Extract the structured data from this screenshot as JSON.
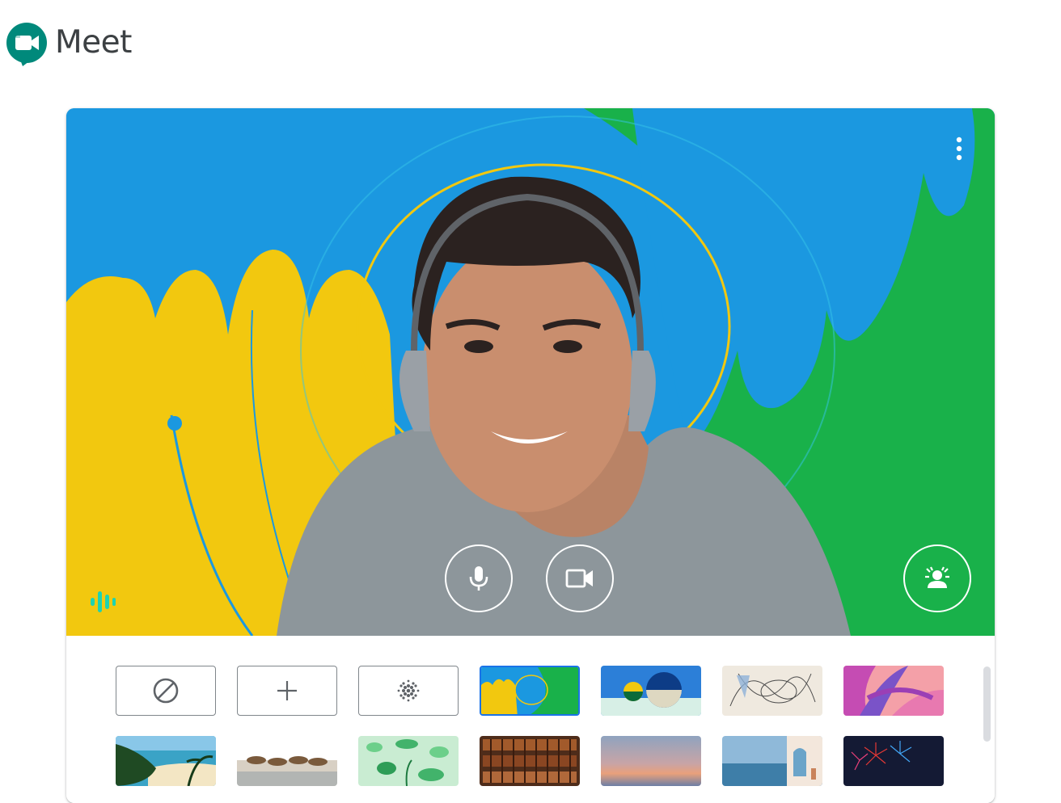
{
  "app": {
    "title": "Meet",
    "logo_icon": "google-meet-logo-icon"
  },
  "preview": {
    "more_options_icon": "more-vert-icon",
    "controls": [
      {
        "name": "microphone-toggle-button",
        "icon": "microphone-icon"
      },
      {
        "name": "camera-toggle-button",
        "icon": "videocam-icon"
      }
    ],
    "effects_button_icon": "visual-effects-icon",
    "audio_indicator_icon": "audio-level-icon"
  },
  "effects": {
    "row1": [
      {
        "name": "no-effect-tile",
        "icon": "no-effect-icon"
      },
      {
        "name": "upload-background-tile",
        "icon": "plus-icon"
      },
      {
        "name": "blur-background-tile",
        "icon": "blur-icon"
      },
      {
        "name": "background-paint-swirl",
        "icon": "thumbnail"
      },
      {
        "name": "background-abstract-spheres",
        "icon": "thumbnail"
      },
      {
        "name": "background-line-sketch",
        "icon": "thumbnail"
      },
      {
        "name": "background-pink-leaves",
        "icon": "thumbnail"
      }
    ],
    "row2": [
      {
        "name": "background-tropical-beach",
        "icon": "thumbnail"
      },
      {
        "name": "background-running-horses",
        "icon": "thumbnail"
      },
      {
        "name": "background-underwater-plants",
        "icon": "thumbnail"
      },
      {
        "name": "background-bookshelf",
        "icon": "thumbnail"
      },
      {
        "name": "background-sunset-gradient",
        "icon": "thumbnail"
      },
      {
        "name": "background-seaside-terrace",
        "icon": "thumbnail"
      },
      {
        "name": "background-fireworks",
        "icon": "thumbnail"
      }
    ]
  },
  "colors": {
    "meet_green": "#00897b",
    "paint_blue": "#1b98e0",
    "paint_yellow": "#f2c80f",
    "paint_green": "#19b14a",
    "border_gray": "#80868b"
  }
}
